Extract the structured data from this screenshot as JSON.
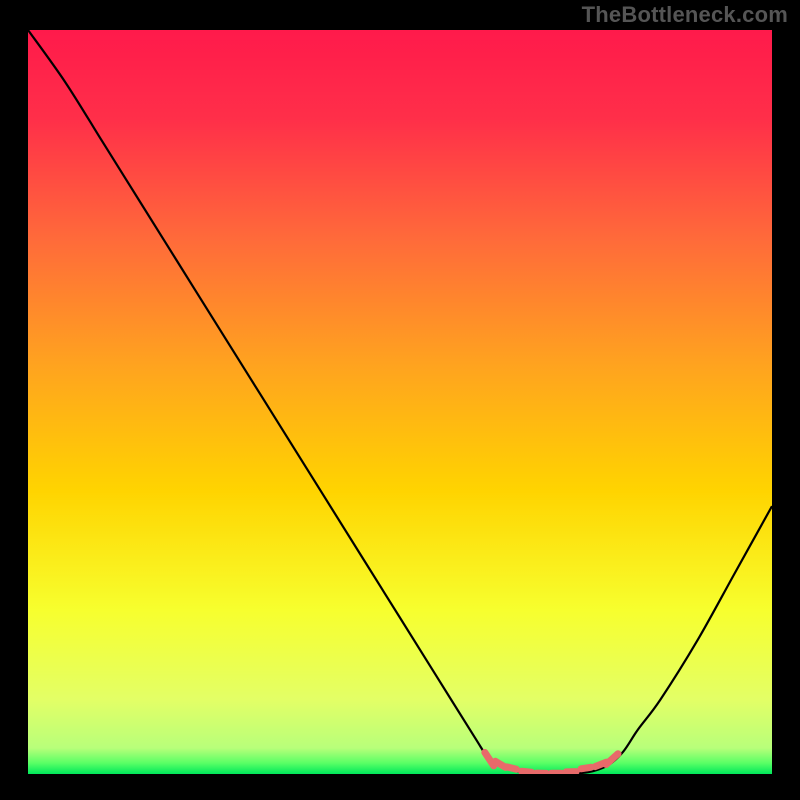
{
  "watermark": "TheBottleneck.com",
  "chart_data": {
    "type": "line",
    "title": "",
    "xlabel": "",
    "ylabel": "",
    "xlim": [
      0,
      100
    ],
    "ylim": [
      0,
      100
    ],
    "series": [
      {
        "name": "bottleneck-curve",
        "x": [
          0,
          5,
          10,
          15,
          20,
          25,
          30,
          35,
          40,
          45,
          50,
          55,
          60,
          62,
          64,
          66,
          68,
          70,
          72,
          74,
          76,
          78,
          80,
          82,
          85,
          90,
          95,
          100
        ],
        "y": [
          100,
          93,
          85,
          77,
          69,
          61,
          53,
          45,
          37,
          29,
          21,
          13,
          5,
          2,
          0.8,
          0.3,
          0.1,
          0.05,
          0.05,
          0.1,
          0.4,
          1.2,
          3,
          6,
          10,
          18,
          27,
          36
        ]
      },
      {
        "name": "acceptable-range-markers",
        "x": [
          62,
          63.5,
          65,
          67,
          69,
          71,
          73,
          75,
          77,
          78.5
        ],
        "y": [
          2.0,
          1.3,
          0.8,
          0.3,
          0.1,
          0.1,
          0.3,
          0.8,
          1.3,
          2.0
        ]
      }
    ],
    "gradient_stops": [
      {
        "offset": 0.0,
        "color": "#ff1a4b"
      },
      {
        "offset": 0.12,
        "color": "#ff2f49"
      },
      {
        "offset": 0.28,
        "color": "#ff6a3a"
      },
      {
        "offset": 0.45,
        "color": "#ffa31f"
      },
      {
        "offset": 0.62,
        "color": "#ffd400"
      },
      {
        "offset": 0.78,
        "color": "#f7ff2e"
      },
      {
        "offset": 0.9,
        "color": "#e3ff66"
      },
      {
        "offset": 0.965,
        "color": "#b8ff7a"
      },
      {
        "offset": 0.985,
        "color": "#5bff66"
      },
      {
        "offset": 1.0,
        "color": "#00e85b"
      }
    ],
    "curve_color": "#000000",
    "marker_color": "#e86a6a"
  }
}
